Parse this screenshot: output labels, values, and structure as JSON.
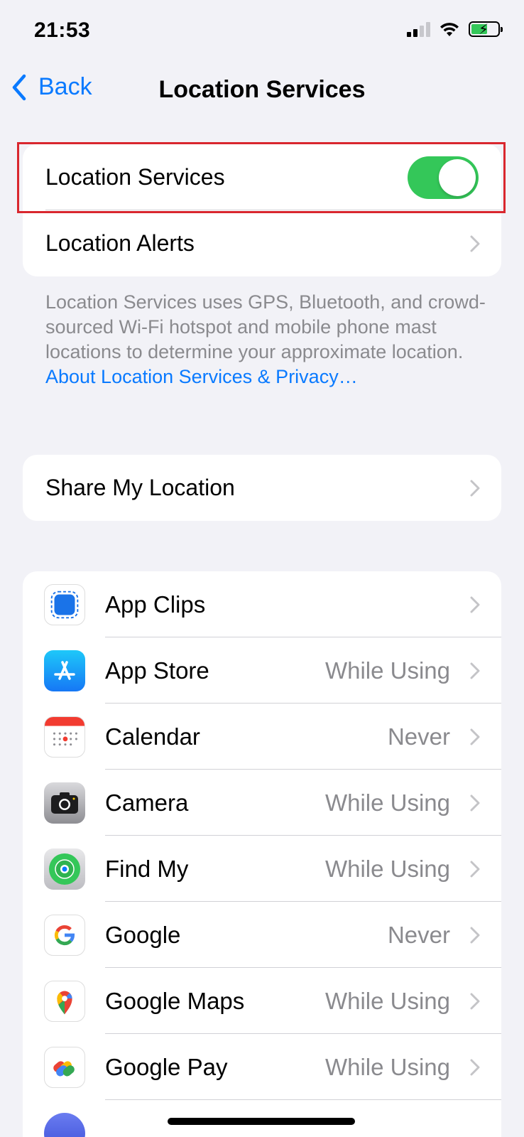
{
  "status_bar": {
    "time": "21:53"
  },
  "nav": {
    "back_label": "Back",
    "title": "Location Services"
  },
  "location_group": {
    "toggle_label": "Location Services",
    "toggle_on": true,
    "alerts_label": "Location Alerts"
  },
  "footnote": {
    "text": "Location Services uses GPS, Bluetooth, and crowd-sourced Wi-Fi hotspot and mobile phone mast locations to determine your approximate location. ",
    "link": "About Location Services & Privacy…"
  },
  "share": {
    "label": "Share My Location"
  },
  "apps": [
    {
      "name": "App Clips",
      "value": "",
      "icon": "app-clips-icon"
    },
    {
      "name": "App Store",
      "value": "While Using",
      "icon": "app-store-icon"
    },
    {
      "name": "Calendar",
      "value": "Never",
      "icon": "calendar-icon"
    },
    {
      "name": "Camera",
      "value": "While Using",
      "icon": "camera-icon"
    },
    {
      "name": "Find My",
      "value": "While Using",
      "icon": "find-my-icon"
    },
    {
      "name": "Google",
      "value": "Never",
      "icon": "google-icon"
    },
    {
      "name": "Google Maps",
      "value": "While Using",
      "icon": "google-maps-icon"
    },
    {
      "name": "Google Pay",
      "value": "While Using",
      "icon": "google-pay-icon"
    }
  ],
  "colors": {
    "accent": "#0a7aff",
    "toggle_on": "#34c759",
    "highlight": "#d9272e",
    "secondary_text": "#8a8a8e"
  }
}
